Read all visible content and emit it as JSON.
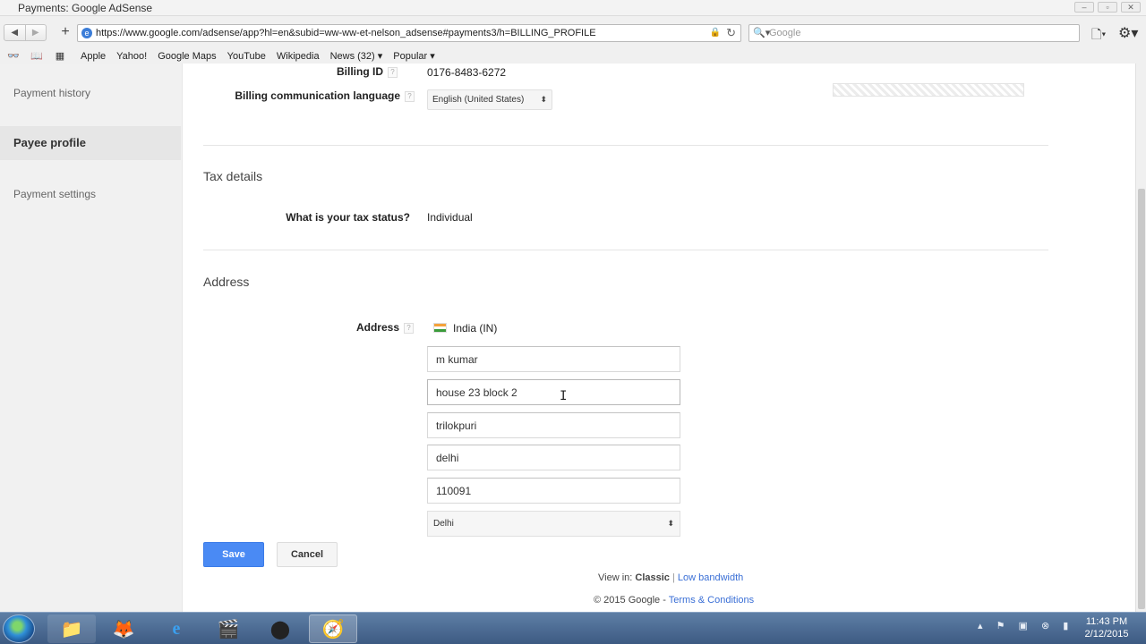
{
  "window": {
    "title": "Payments: Google AdSense",
    "url": "https://www.google.com/adsense/app?hl=en&subid=ww-ww-et-nelson_adsense#payments3/h=BILLING_PROFILE",
    "search_placeholder": "Google"
  },
  "bookmarks": [
    "Apple",
    "Yahoo!",
    "Google Maps",
    "YouTube",
    "Wikipedia",
    "News (32) ▾",
    "Popular ▾"
  ],
  "sidebar": {
    "items": [
      {
        "label": "Payment history"
      },
      {
        "label": "Payee profile"
      },
      {
        "label": "Payment settings"
      }
    ]
  },
  "billing": {
    "billing_id_label": "Billing ID",
    "billing_id_value": "0176-8483-6272",
    "language_label": "Billing communication language",
    "language_value": "English (United States)"
  },
  "tax": {
    "section_title": "Tax details",
    "question": "What is your tax status?",
    "answer": "Individual"
  },
  "address": {
    "section_title": "Address",
    "label": "Address",
    "country": "India (IN)",
    "name": "m kumar",
    "line1": "house 23 block 2",
    "line2": "trilokpuri",
    "city": "delhi",
    "postal_code": "110091",
    "state": "Delhi"
  },
  "buttons": {
    "save": "Save",
    "cancel": "Cancel"
  },
  "footer": {
    "view_in": "View in:",
    "classic": "Classic",
    "separator": "|",
    "low_bandwidth": "Low bandwidth",
    "copyright": "© 2015 Google",
    "dash": "-",
    "terms": "Terms & Conditions"
  },
  "taskbar": {
    "time": "11:43 PM",
    "date": "2/12/2015"
  }
}
